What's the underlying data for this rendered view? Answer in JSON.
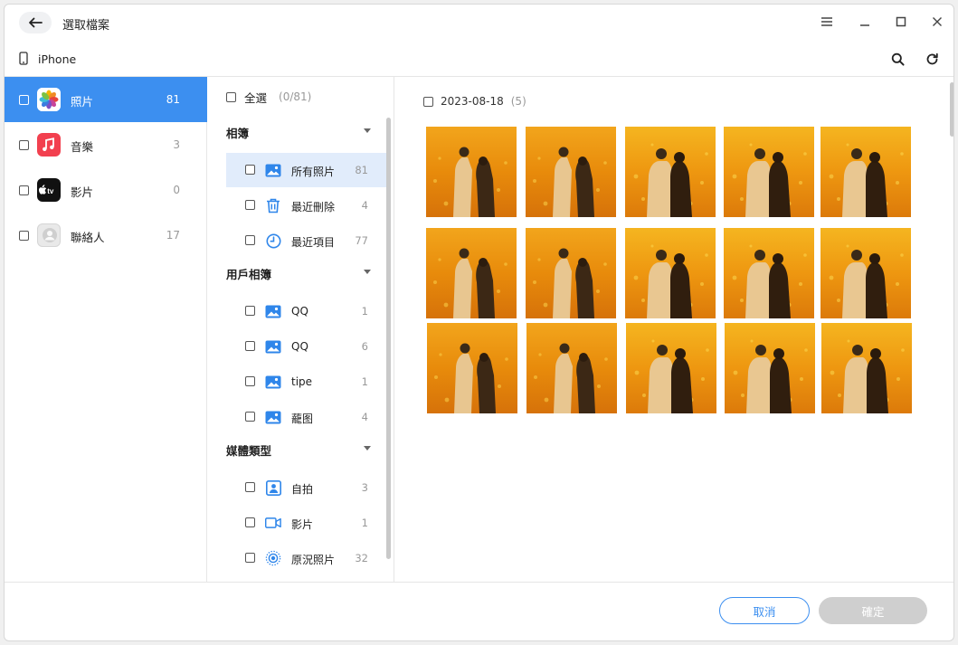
{
  "window": {
    "title": "選取檔案"
  },
  "device": {
    "name": "iPhone"
  },
  "categories": [
    {
      "label": "照片",
      "count": "81",
      "icon": "photos-app-icon",
      "active": true
    },
    {
      "label": "音樂",
      "count": "3",
      "icon": "music-app-icon"
    },
    {
      "label": "影片",
      "count": "0",
      "icon": "appletv-app-icon"
    },
    {
      "label": "聯絡人",
      "count": "17",
      "icon": "contacts-app-icon"
    }
  ],
  "albums_panel": {
    "select_all_label": "全選",
    "select_all_count": "(0/81)",
    "sections": [
      {
        "title": "相簿",
        "items": [
          {
            "label": "所有照片",
            "count": "81",
            "icon": "album-icon",
            "active": true
          },
          {
            "label": "最近刪除",
            "count": "4",
            "icon": "trash-icon"
          },
          {
            "label": "最近項目",
            "count": "77",
            "icon": "clock-icon"
          }
        ]
      },
      {
        "title": "用戶相簿",
        "items": [
          {
            "label": "QQ",
            "count": "1",
            "icon": "album-icon"
          },
          {
            "label": "QQ",
            "count": "6",
            "icon": "album-icon"
          },
          {
            "label": "tipe",
            "count": "1",
            "icon": "album-icon"
          },
          {
            "label": "蘢图",
            "count": "4",
            "icon": "album-icon"
          }
        ]
      },
      {
        "title": "媒體類型",
        "items": [
          {
            "label": "自拍",
            "count": "3",
            "icon": "selfie-icon"
          },
          {
            "label": "影片",
            "count": "1",
            "icon": "video-icon"
          },
          {
            "label": "原況照片",
            "count": "32",
            "icon": "live-photo-icon"
          }
        ]
      }
    ]
  },
  "photo_group": {
    "date": "2023-08-18",
    "count": "(5)"
  },
  "footer": {
    "cancel_label": "取消",
    "ok_label": "確定"
  },
  "colors": {
    "accent": "#3c8ff0",
    "selected_album_bg": "#e1ecfb",
    "disabled_button": "#cfcfcf"
  }
}
